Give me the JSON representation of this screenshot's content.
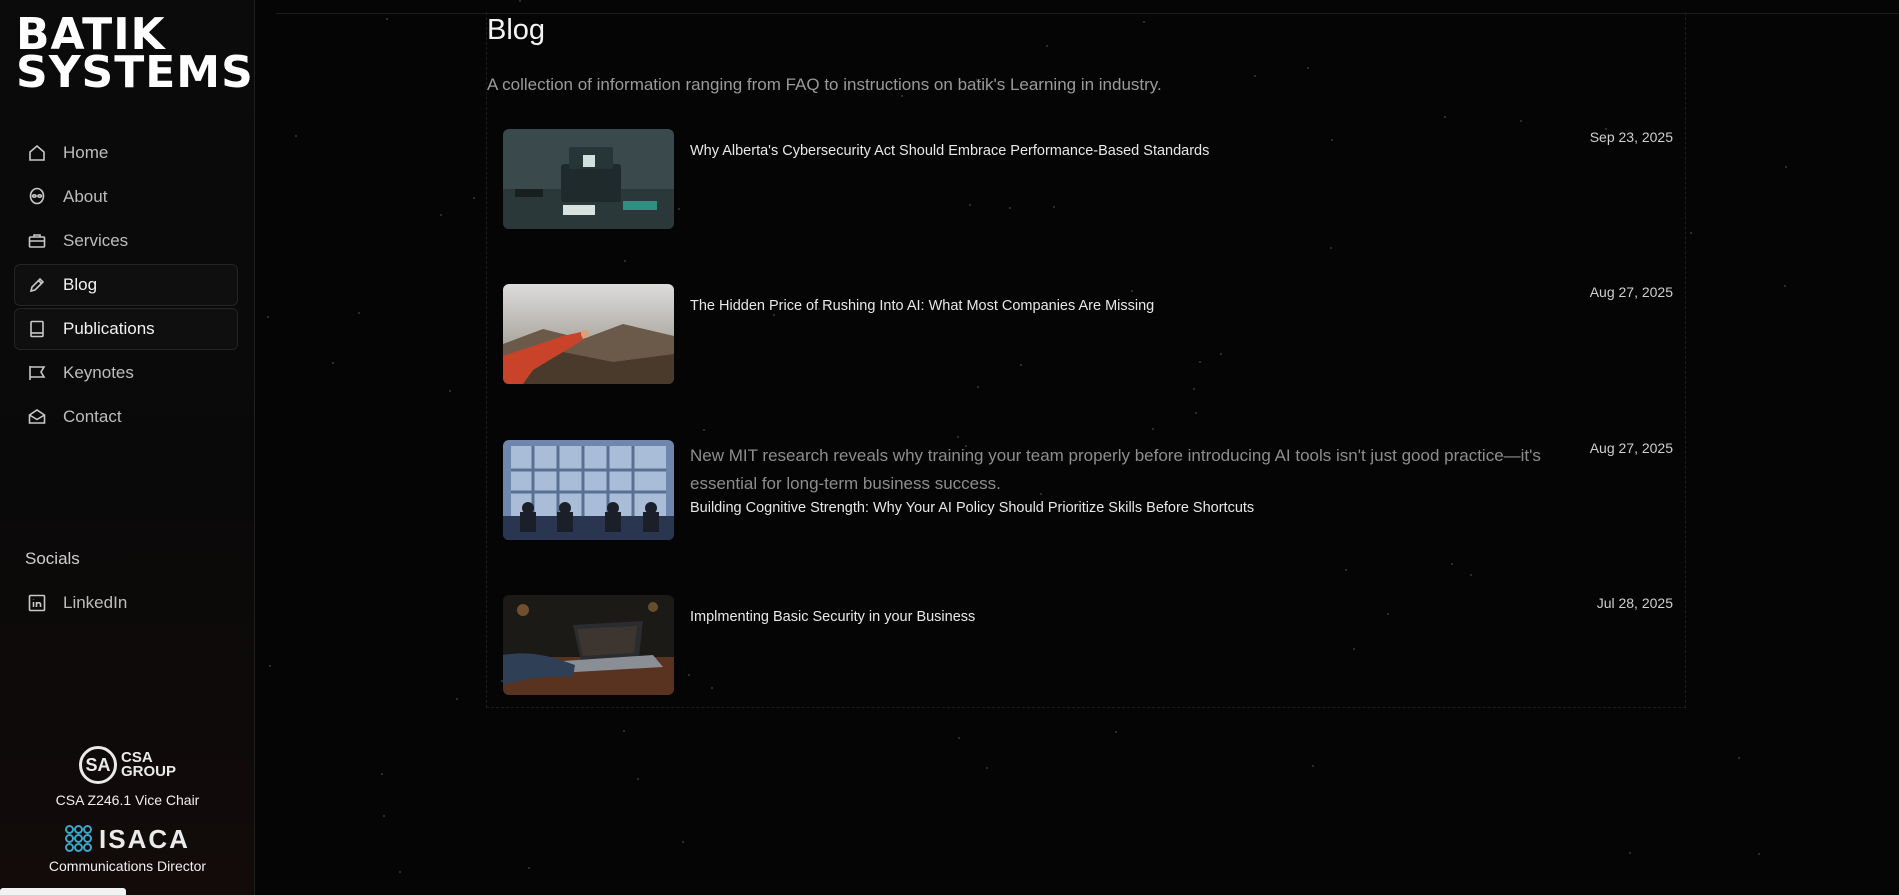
{
  "brand": {
    "line1": "BATIK",
    "line2": "SYSTEMS"
  },
  "nav": [
    {
      "label": "Home",
      "icon": "home-icon"
    },
    {
      "label": "About",
      "icon": "alien-icon"
    },
    {
      "label": "Services",
      "icon": "briefcase-icon"
    },
    {
      "label": "Blog",
      "icon": "pencil-icon",
      "active": true
    },
    {
      "label": "Publications",
      "icon": "book-icon"
    },
    {
      "label": "Keynotes",
      "icon": "presentation-icon"
    },
    {
      "label": "Contact",
      "icon": "mail-icon"
    }
  ],
  "socials": {
    "title": "Socials",
    "linkedin": "LinkedIn"
  },
  "badges": {
    "csa_mark": "SA",
    "csa_text_line1": "CSA",
    "csa_text_line2": "GROUP",
    "csa_caption": "CSA Z246.1 Vice Chair",
    "isaca_word": "ISACA",
    "isaca_caption": "Communications Director"
  },
  "page": {
    "title": "Blog",
    "subtitle": "A collection of information ranging from FAQ to instructions on batik's Learning in industry."
  },
  "posts": [
    {
      "title": "Why Alberta's Cybersecurity Act Should Embrace Performance-Based Standards",
      "date": "Sep 23, 2025",
      "excerpt": ""
    },
    {
      "title": "The Hidden Price of Rushing Into AI: What Most Companies Are Missing",
      "date": "Aug 27, 2025",
      "excerpt": ""
    },
    {
      "title": "Building Cognitive Strength: Why Your AI Policy Should Prioritize Skills Before Shortcuts",
      "date": "Aug 27, 2025",
      "excerpt": "New MIT research reveals why training your team properly before introducing AI tools isn't just good practice—it's essential for long-term business success."
    },
    {
      "title": "Implmenting Basic Security in your Business",
      "date": "Jul 28, 2025",
      "excerpt": ""
    }
  ],
  "colors": {
    "background": "#050505",
    "accent_isaca": "#3aa7c9"
  }
}
